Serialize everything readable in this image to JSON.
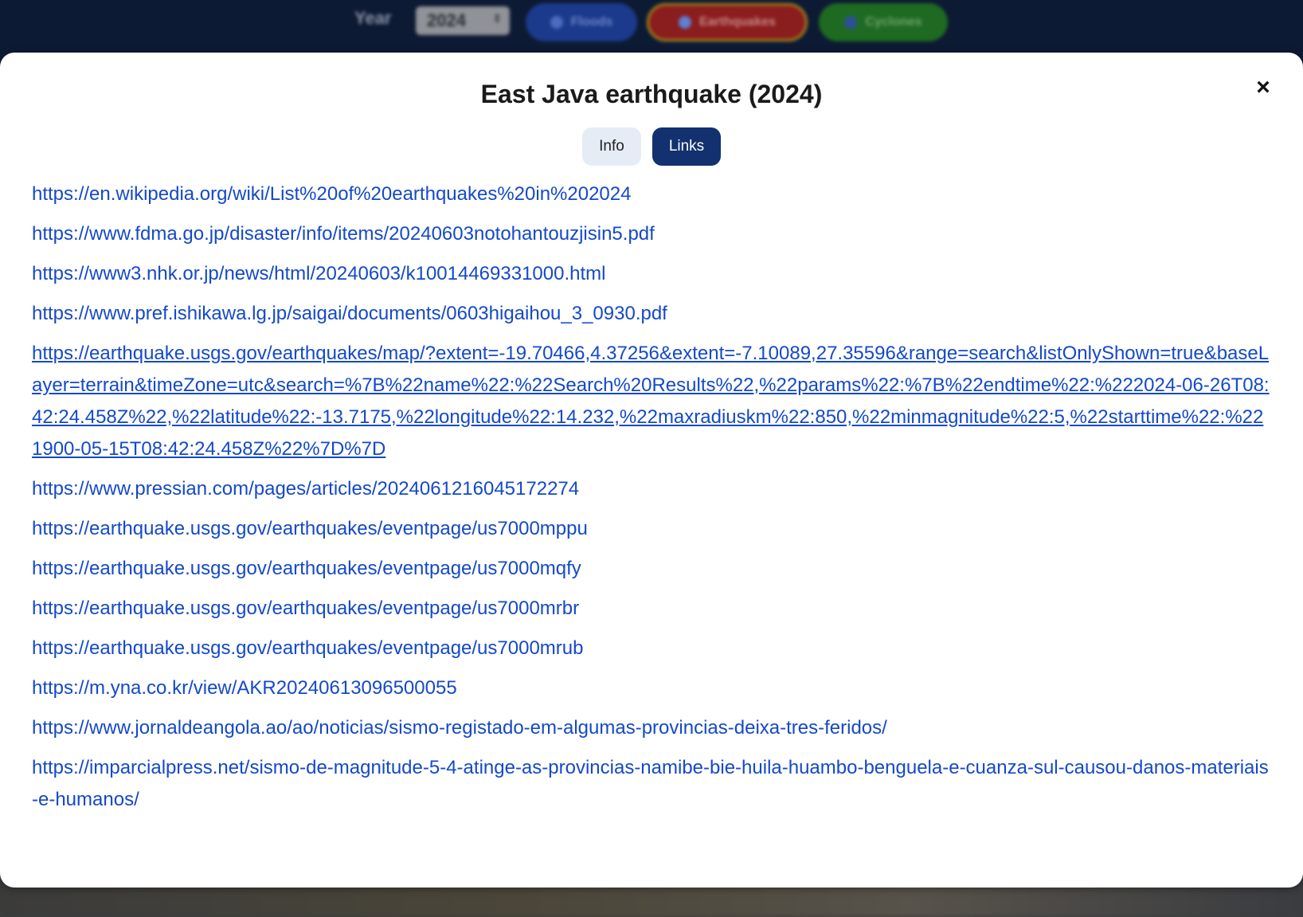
{
  "toolbar": {
    "year_label": "Year",
    "year_value": "2024",
    "filters": [
      {
        "label": "Floods",
        "color": "#1c3a8c"
      },
      {
        "label": "Earthquakes",
        "color": "#8a1d1d"
      },
      {
        "label": "Cyclones",
        "color": "#1f6a22"
      }
    ]
  },
  "modal": {
    "title": "East Java earthquake (2024)",
    "close_symbol": "×",
    "tabs": [
      {
        "label": "Info",
        "active": false
      },
      {
        "label": "Links",
        "active": true
      }
    ],
    "links": [
      {
        "url": "https://en.wikipedia.org/wiki/List%20of%20earthquakes%20in%202024",
        "hovered": false
      },
      {
        "url": "https://www.fdma.go.jp/disaster/info/items/20240603notohantouzjisin5.pdf",
        "hovered": false
      },
      {
        "url": "https://www3.nhk.or.jp/news/html/20240603/k10014469331000.html",
        "hovered": false
      },
      {
        "url": "https://www.pref.ishikawa.lg.jp/saigai/documents/0603higaihou_3_0930.pdf",
        "hovered": false
      },
      {
        "url": "https://earthquake.usgs.gov/earthquakes/map/?extent=-19.70466,4.37256&extent=-7.10089,27.35596&range=search&listOnlyShown=true&baseLayer=terrain&timeZone=utc&search=%7B%22name%22:%22Search%20Results%22,%22params%22:%7B%22endtime%22:%222024-06-26T08:42:24.458Z%22,%22latitude%22:-13.7175,%22longitude%22:14.232,%22maxradiuskm%22:850,%22minmagnitude%22:5,%22starttime%22:%221900-05-15T08:42:24.458Z%22%7D%7D",
        "hovered": true
      },
      {
        "url": "https://www.pressian.com/pages/articles/2024061216045172274",
        "hovered": false
      },
      {
        "url": "https://earthquake.usgs.gov/earthquakes/eventpage/us7000mppu",
        "hovered": false
      },
      {
        "url": "https://earthquake.usgs.gov/earthquakes/eventpage/us7000mqfy",
        "hovered": false
      },
      {
        "url": "https://earthquake.usgs.gov/earthquakes/eventpage/us7000mrbr",
        "hovered": false
      },
      {
        "url": "https://earthquake.usgs.gov/earthquakes/eventpage/us7000mrub",
        "hovered": false
      },
      {
        "url": "https://m.yna.co.kr/view/AKR20240613096500055",
        "hovered": false
      },
      {
        "url": "https://www.jornaldeangola.ao/ao/noticias/sismo-registado-em-algumas-provincias-deixa-tres-feridos/",
        "hovered": false
      },
      {
        "url": "https://imparcialpress.net/sismo-de-magnitude-5-4-atinge-as-provincias-namibe-bie-huila-huambo-benguela-e-cuanza-sul-causou-danos-materiais-e-humanos/",
        "hovered": false
      }
    ]
  },
  "colors": {
    "link": "#1449c8",
    "active_tab": "#12316e",
    "inactive_tab": "#e5ecf6"
  }
}
